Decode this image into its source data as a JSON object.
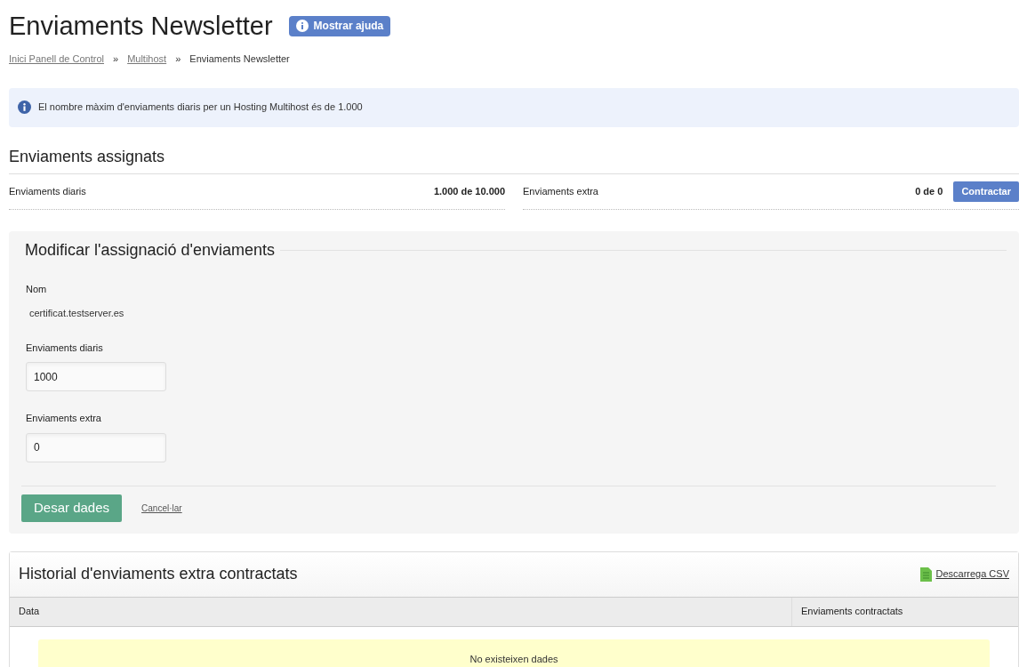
{
  "page_title": "Enviaments Newsletter",
  "help_button": "Mostrar ajuda",
  "breadcrumb": [
    {
      "label": "Inici Panell de Control",
      "kind": "link"
    },
    {
      "label": "»",
      "kind": "separator"
    },
    {
      "label": "Multihost",
      "kind": "link"
    },
    {
      "label": "»",
      "kind": "separator"
    },
    {
      "label": "Enviaments Newsletter",
      "kind": "current"
    }
  ],
  "info_alert": "El nombre màxim d'enviaments diaris per un Hosting Multihost és de 1.000",
  "assigned": {
    "title": "Enviaments assignats",
    "items": [
      {
        "label": "Enviaments diaris",
        "value": "1.000 de 10.000"
      },
      {
        "label": "Enviaments extra",
        "value": "0 de 0",
        "button": "Contractar"
      }
    ]
  },
  "form": {
    "title": "Modificar l'assignació d'enviaments",
    "name_label": "Nom",
    "name_value": "certificat.testserver.es",
    "fields": [
      {
        "label": "Enviaments diaris",
        "value": "1000"
      },
      {
        "label": "Enviaments extra",
        "value": "0"
      }
    ],
    "save_button": "Desar dades",
    "cancel_link": "Cancel·lar"
  },
  "history": {
    "title": "Historial d'enviaments extra contractats",
    "csv_link": "Descarrega CSV",
    "columns": [
      "Data",
      "Enviaments contractats"
    ],
    "empty_message": "No existeixen dades"
  }
}
